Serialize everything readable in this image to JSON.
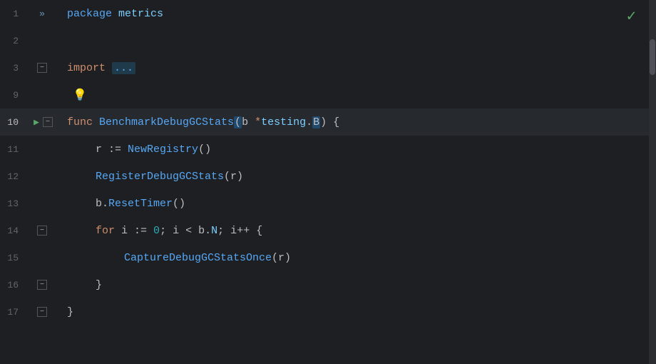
{
  "editor": {
    "title": "package metrics",
    "checkmark": "✓",
    "lines": [
      {
        "num": "1",
        "hasRun": false,
        "hasFold": false,
        "hasDoubleFold": true,
        "content": "package_metrics",
        "highlighted": false
      },
      {
        "num": "2",
        "content": "",
        "highlighted": false
      },
      {
        "num": "3",
        "content": "import_dots",
        "hasFold": true,
        "highlighted": false
      },
      {
        "num": "9",
        "content": "bulb",
        "highlighted": false
      },
      {
        "num": "10",
        "hasRun": true,
        "hasFold": true,
        "content": "func_benchmark",
        "highlighted": true
      },
      {
        "num": "11",
        "content": "r_newregistry",
        "highlighted": false
      },
      {
        "num": "12",
        "content": "registerdebug",
        "highlighted": false
      },
      {
        "num": "13",
        "content": "resettimer",
        "highlighted": false
      },
      {
        "num": "14",
        "hasFold": true,
        "content": "for_loop",
        "highlighted": false
      },
      {
        "num": "15",
        "content": "capture",
        "highlighted": false
      },
      {
        "num": "16",
        "hasFold": true,
        "content": "close_brace",
        "highlighted": false
      },
      {
        "num": "17",
        "hasFold": true,
        "content": "close_brace2",
        "highlighted": false
      }
    ]
  }
}
